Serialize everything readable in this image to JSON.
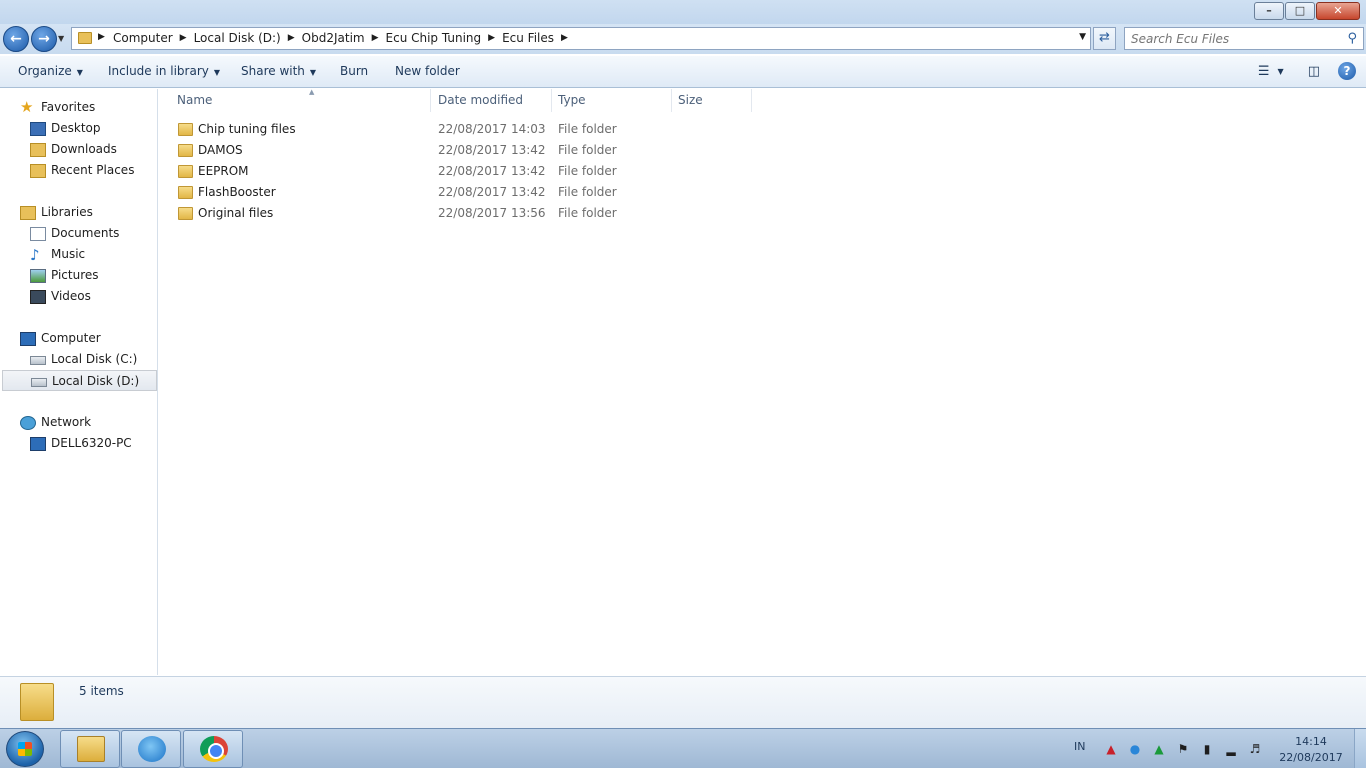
{
  "window": {
    "minimize": "–",
    "maximize": "□",
    "close": "✕"
  },
  "address": {
    "crumbs": [
      "Computer",
      "Local Disk (D:)",
      "Obd2Jatim",
      "Ecu Chip Tuning",
      "Ecu Files"
    ],
    "search_placeholder": "Search Ecu Files"
  },
  "toolbar": {
    "organize": "Organize",
    "include_in_library": "Include in library",
    "share_with": "Share with",
    "burn": "Burn",
    "new_folder": "New folder",
    "help": "?"
  },
  "nav": {
    "favorites": "Favorites",
    "desktop": "Desktop",
    "downloads": "Downloads",
    "recent_places": "Recent Places",
    "libraries": "Libraries",
    "documents": "Documents",
    "music": "Music",
    "pictures": "Pictures",
    "videos": "Videos",
    "computer": "Computer",
    "local_disk_c": "Local Disk (C:)",
    "local_disk_d": "Local Disk (D:)",
    "network": "Network",
    "dell_pc": "DELL6320-PC"
  },
  "columns": {
    "name": "Name",
    "date_modified": "Date modified",
    "type": "Type",
    "size": "Size"
  },
  "files": [
    {
      "name": "Chip tuning files",
      "date": "22/08/2017 14:03",
      "type": "File folder"
    },
    {
      "name": "DAMOS",
      "date": "22/08/2017 13:42",
      "type": "File folder"
    },
    {
      "name": "EEPROM",
      "date": "22/08/2017 13:42",
      "type": "File folder"
    },
    {
      "name": "FlashBooster",
      "date": "22/08/2017 13:42",
      "type": "File folder"
    },
    {
      "name": "Original files",
      "date": "22/08/2017 13:56",
      "type": "File folder"
    }
  ],
  "details": {
    "item_count": "5 items"
  },
  "taskbar": {
    "lang": "IN",
    "time": "14:14",
    "date": "22/08/2017"
  },
  "colors": {
    "accent": "#1c5aa8",
    "folder": "#e8c05a",
    "taskbar": "#a9c3df"
  }
}
